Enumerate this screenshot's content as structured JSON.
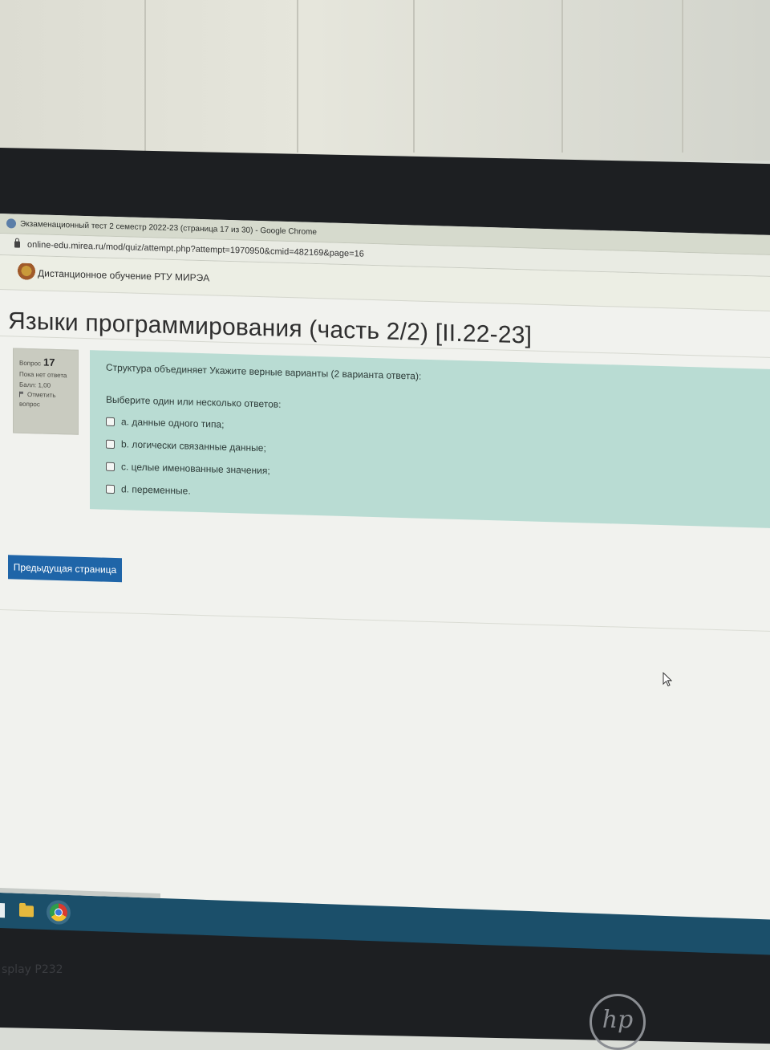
{
  "window": {
    "title": "Экзаменационный тест 2 семестр 2022-23 (страница 17 из 30) - Google Chrome",
    "url": "online-edu.mirea.ru/mod/quiz/attempt.php?attempt=1970950&cmid=482169&page=16"
  },
  "site": {
    "name": "Дистанционное обучение РТУ МИРЭА",
    "emblem_icon": "coat-of-arms-icon"
  },
  "course": {
    "title": "Языки программирования (часть 2/2) [II.22-23]"
  },
  "question": {
    "label": "Вопрос",
    "number": "17",
    "status": "Пока нет ответа",
    "score": "Балл: 1,00",
    "flag_label": "Отметить вопрос",
    "text": "Структура объединяет Укажите верные варианты (2 варианта ответа):",
    "prompt": "Выберите один или несколько ответов:",
    "options": [
      {
        "label": "a. данные одного типа;"
      },
      {
        "label": "b. логически связанные данные;"
      },
      {
        "label": "c. целые именованные значения;"
      },
      {
        "label": "d. переменные."
      }
    ]
  },
  "navigation": {
    "prev_label": "Предыдущая страница"
  },
  "monitor": {
    "bezel_label": "splay P232",
    "brand": "hp"
  },
  "colors": {
    "question_bg": "#b9dcd3",
    "button_bg": "#1f65a8",
    "taskbar_bg": "#1b4f6a"
  }
}
